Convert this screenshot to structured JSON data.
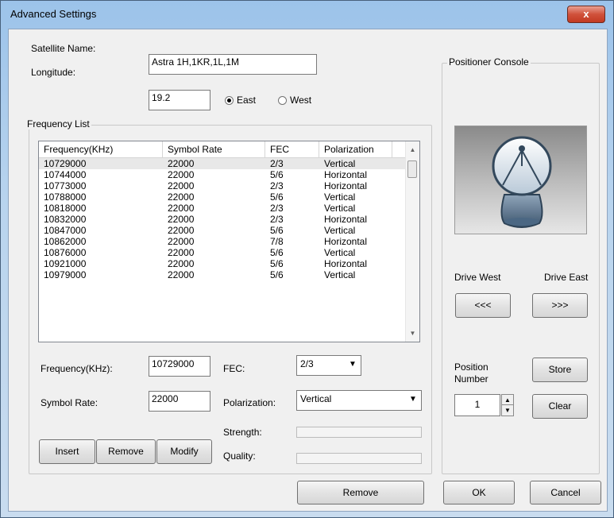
{
  "window": {
    "title": "Advanced Settings",
    "close_glyph": "x"
  },
  "satellite": {
    "name_label": "Satellite Name:",
    "name_value": "Astra 1H,1KR,1L,1M",
    "longitude_label": "Longitude:",
    "longitude_value": "19.2",
    "east_label": "East",
    "west_label": "West",
    "direction_selected": "East"
  },
  "frequency_list": {
    "group_label": "Frequency List",
    "columns": [
      "Frequency(KHz)",
      "Symbol Rate",
      "FEC",
      "Polarization"
    ],
    "rows": [
      [
        "10729000",
        "22000",
        "2/3",
        "Vertical"
      ],
      [
        "10744000",
        "22000",
        "5/6",
        "Horizontal"
      ],
      [
        "10773000",
        "22000",
        "2/3",
        "Horizontal"
      ],
      [
        "10788000",
        "22000",
        "5/6",
        "Vertical"
      ],
      [
        "10818000",
        "22000",
        "2/3",
        "Vertical"
      ],
      [
        "10832000",
        "22000",
        "2/3",
        "Horizontal"
      ],
      [
        "10847000",
        "22000",
        "5/6",
        "Vertical"
      ],
      [
        "10862000",
        "22000",
        "7/8",
        "Horizontal"
      ],
      [
        "10876000",
        "22000",
        "5/6",
        "Vertical"
      ],
      [
        "10921000",
        "22000",
        "5/6",
        "Horizontal"
      ],
      [
        "10979000",
        "22000",
        "5/6",
        "Vertical"
      ]
    ]
  },
  "editor": {
    "frequency_label": "Frequency(KHz):",
    "frequency_value": "10729000",
    "fec_label": "FEC:",
    "fec_value": "2/3",
    "symbol_rate_label": "Symbol Rate:",
    "symbol_rate_value": "22000",
    "polarization_label": "Polarization:",
    "polarization_value": "Vertical",
    "strength_label": "Strength:",
    "quality_label": "Quality:",
    "insert_label": "Insert",
    "remove_label": "Remove",
    "modify_label": "Modify"
  },
  "footer": {
    "remove_label": "Remove",
    "ok_label": "OK",
    "cancel_label": "Cancel"
  },
  "positioner": {
    "group_label": "Positioner Console",
    "icon": "satellite-dish-icon",
    "drive_west_label": "Drive West",
    "drive_east_label": "Drive East",
    "west_button": "<<<",
    "east_button": ">>>",
    "position_label_1": "Position",
    "position_label_2": "Number",
    "position_value": "1",
    "store_label": "Store",
    "clear_label": "Clear"
  }
}
